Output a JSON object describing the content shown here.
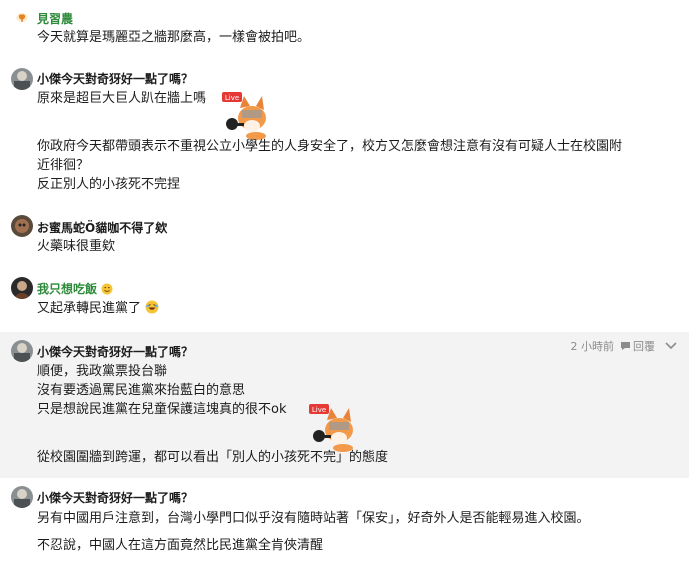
{
  "comments": [
    {
      "name": "見習農",
      "lines": [
        "今天就算是瑪麗亞之牆那麼高，一樣會被拍吧。"
      ]
    },
    {
      "name": "小傑今天對奇犽好一點了嗎？",
      "lines": [
        "原來是超巨大巨人趴在牆上嗎",
        "你政府今天都帶頭表示不重視公立小學生的人身安全了，校方又怎麼會想注意有沒有可疑人士在校園附",
        "近徘徊？",
        "反正別人的小孩死不完捏"
      ],
      "sticker_badge": "Live"
    },
    {
      "name": "お蜜馬蛇Ö貓咖不得了欸",
      "lines": [
        "火藥味很重欸"
      ]
    },
    {
      "name": "我只想吃飯",
      "lines": [
        "又起承轉民進黨了"
      ]
    },
    {
      "name": "小傑今天對奇犽好一點了嗎？",
      "time": "2 小時前",
      "reply": "回覆",
      "lines": [
        "順便，我政黨票投台聯",
        "沒有要透過罵民進黨來抬藍白的意思",
        "只是想說民進黨在兒童保護這塊真的很不ok",
        "從校園圍牆到跨運，都可以看出「別人的小孩死不完」的態度"
      ],
      "sticker_badge": "Live"
    },
    {
      "name": "小傑今天對奇犽好一點了嗎？",
      "lines": [
        "另有中國用戶注意到，台灣小學門口似乎沒有隨時站著「保安」，好奇外人是否能輕易進入校園。",
        "不忍說，中國人在這方面竟然比民進黨全肯俠清醒"
      ]
    }
  ],
  "colors": {
    "highlight_bg": "#f3f3f4",
    "green_name": "#2e8b3a",
    "meta": "#8c8c8c"
  },
  "icons": [
    "sprout-avatar-icon",
    "fox-sticker-icon",
    "smile-emoji-icon",
    "laugh-emoji-icon",
    "reply-bubble-icon",
    "chevron-down-icon"
  ]
}
